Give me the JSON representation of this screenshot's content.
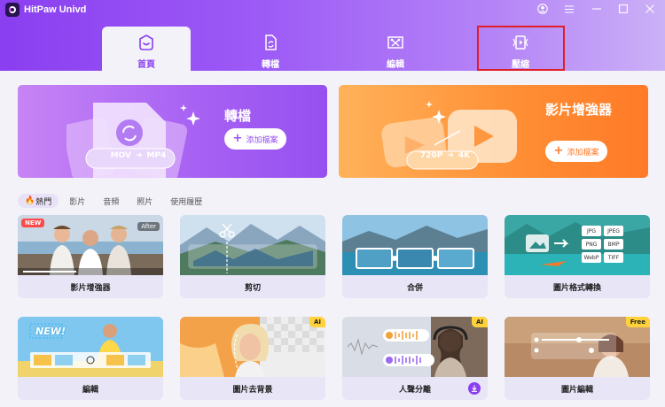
{
  "app": {
    "title": "HitPaw Univd"
  },
  "window_controls": [
    {
      "name": "account-icon"
    },
    {
      "name": "menu-icon"
    },
    {
      "name": "minimize-icon"
    },
    {
      "name": "maximize-icon"
    },
    {
      "name": "close-icon"
    }
  ],
  "tabs": [
    {
      "label": "首頁",
      "icon": "home-icon",
      "active": true
    },
    {
      "label": "轉檔",
      "icon": "convert-icon",
      "active": false
    },
    {
      "label": "編輯",
      "icon": "edit-icon",
      "active": false
    },
    {
      "label": "壓縮",
      "icon": "compress-icon",
      "active": false
    }
  ],
  "banners": {
    "convert": {
      "title": "轉檔",
      "button": "添加檔案",
      "from": "MOV",
      "to": "MP4"
    },
    "enhance": {
      "title": "影片增強器",
      "button": "添加檔案",
      "from": "720P",
      "to": "4K"
    }
  },
  "filters": [
    "熱門",
    "影片",
    "音頻",
    "照片",
    "使用履歷"
  ],
  "filters_prefix_icon": "fire-icon",
  "cards": [
    {
      "label": "影片增強器",
      "badge": "NEW",
      "overlay": "After"
    },
    {
      "label": "剪切"
    },
    {
      "label": "合併"
    },
    {
      "label": "圖片格式轉換",
      "formats": [
        "JPG",
        "JPEG",
        "PNG",
        "BMP",
        "WebP",
        "TIFF"
      ]
    },
    {
      "label": "編輯",
      "overlay": "NEW!"
    },
    {
      "label": "圖片去背景",
      "badge": "AI"
    },
    {
      "label": "人聲分離",
      "badge": "AI"
    },
    {
      "label": "圖片編輯",
      "badge": "Free"
    }
  ],
  "colors": {
    "accent": "#8a3ff0",
    "highlight": "#e01e28",
    "orange": "#ff7a28"
  }
}
